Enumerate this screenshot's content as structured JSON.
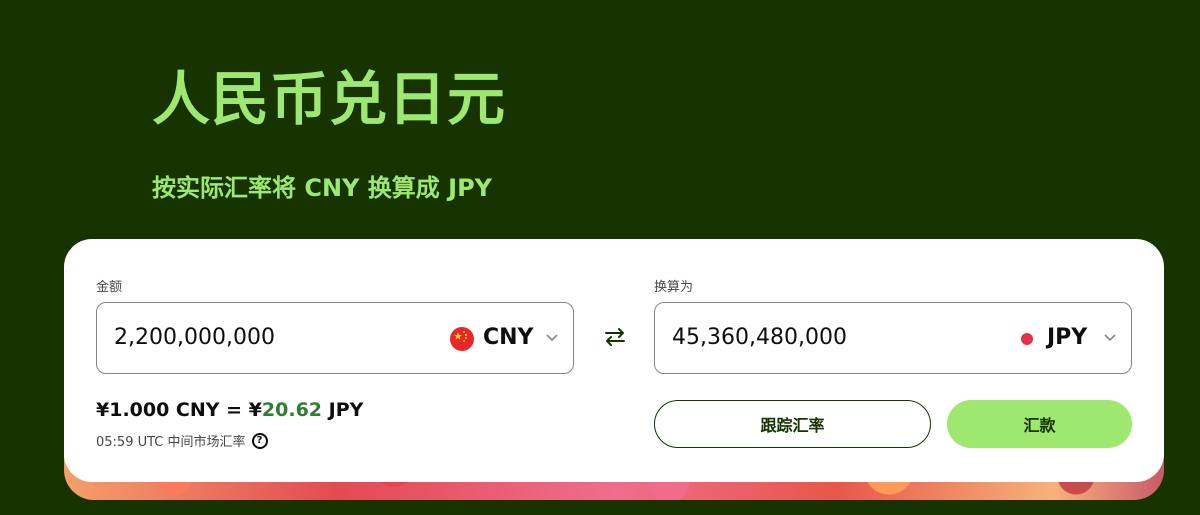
{
  "header": {
    "title": "人民币兑日元",
    "subtitle": "按实际汇率将 CNY 换算成 JPY"
  },
  "converter": {
    "amount": {
      "label": "金额",
      "value": "2,200,000,000",
      "currency": "CNY",
      "flag_icon": "china-flag-icon"
    },
    "converted": {
      "label": "换算为",
      "value": "45,360,480,000",
      "currency": "JPY",
      "flag_icon": "japan-flag-icon"
    },
    "swap_icon": "swap-arrows-icon",
    "rate": {
      "prefix": "¥1.000 CNY = ¥",
      "highlight": "20.62",
      "suffix": " JPY",
      "meta": "05:59 UTC 中间市场汇率",
      "help_glyph": "?"
    },
    "buttons": {
      "track": "跟踪汇率",
      "send": "汇款"
    }
  },
  "colors": {
    "brand_dark": "#163300",
    "brand_green": "#9fe870",
    "rate_highlight": "#2f7d32"
  }
}
